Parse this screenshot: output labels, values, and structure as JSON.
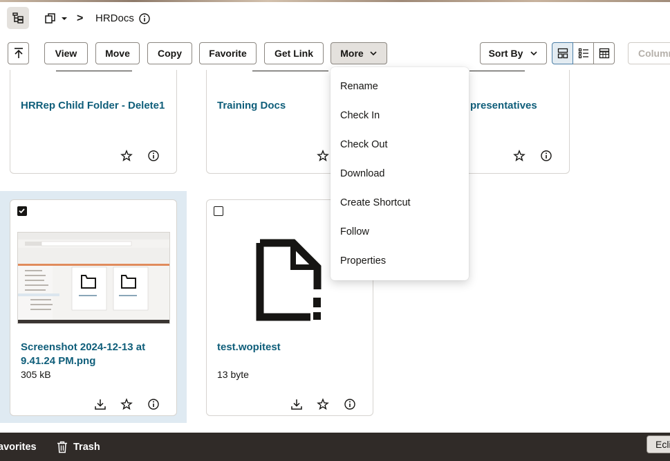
{
  "header": {
    "breadcrumb_separator": ">",
    "current_folder": "HRDocs"
  },
  "toolbar": {
    "view_label": "View",
    "move_label": "Move",
    "copy_label": "Copy",
    "favorite_label": "Favorite",
    "get_link_label": "Get Link",
    "more_label": "More",
    "sort_label": "Sort By",
    "columns_label": "Columns"
  },
  "cards": [
    {
      "title": "HRRep Child Folder - Delete1",
      "type": "folder"
    },
    {
      "title": "Training Docs",
      "type": "folder"
    },
    {
      "title": "HR Representatives",
      "visible_title": "presentatives",
      "type": "folder"
    },
    {
      "title_line1": "Screenshot 2024-12-13 at",
      "title_line2": "9.41.24 PM.png",
      "size": "305 kB",
      "selected": true
    },
    {
      "title": "test.wopitest",
      "size": "13 byte",
      "selected": false
    }
  ],
  "more_menu": {
    "items": [
      "Rename",
      "Check In",
      "Check Out",
      "Download",
      "Create Shortcut",
      "Follow",
      "Properties"
    ]
  },
  "bottom_bar": {
    "favorites_label": "avorites",
    "trash_label": "Trash",
    "pill_label": "Eclipse"
  },
  "colors": {
    "link": "#0f5e7a",
    "selected_background": "#dfeaf2",
    "bottom_bar": "#302b28",
    "active_view": "#e3ecf2"
  }
}
